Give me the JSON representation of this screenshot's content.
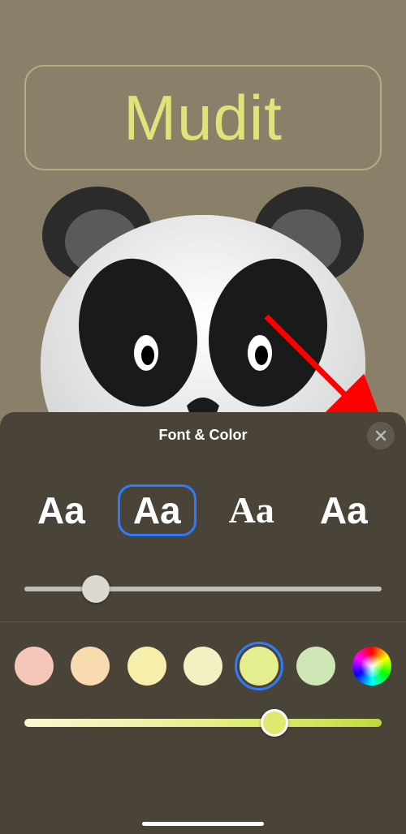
{
  "contact": {
    "name": "Mudit"
  },
  "sheet": {
    "title": "Font & Color",
    "close_icon": "close-icon",
    "fonts": {
      "options": [
        {
          "label": "Aa",
          "style": "sans-black",
          "selected": false
        },
        {
          "label": "Aa",
          "style": "sans-bold",
          "selected": true
        },
        {
          "label": "Aa",
          "style": "serif",
          "selected": false
        },
        {
          "label": "Aa",
          "style": "slab",
          "selected": false
        }
      ],
      "weight_slider": {
        "min": 0,
        "max": 100,
        "value": 20
      }
    },
    "colors": {
      "swatches": [
        {
          "hex": "#f5c7bb",
          "selected": false
        },
        {
          "hex": "#f8dcb0",
          "selected": false
        },
        {
          "hex": "#f6eeab",
          "selected": false
        },
        {
          "hex": "#f1f1c3",
          "selected": false
        },
        {
          "hex": "#e4ee8e",
          "selected": true
        },
        {
          "hex": "#cfe7b6",
          "selected": false
        }
      ],
      "picker_icon": "color-wheel-icon",
      "hue_slider": {
        "min": 0,
        "max": 100,
        "value": 70,
        "selected_hex": "#dfe86f"
      }
    }
  },
  "annotation": {
    "arrow_target": "close-button",
    "color": "#ff0000"
  }
}
